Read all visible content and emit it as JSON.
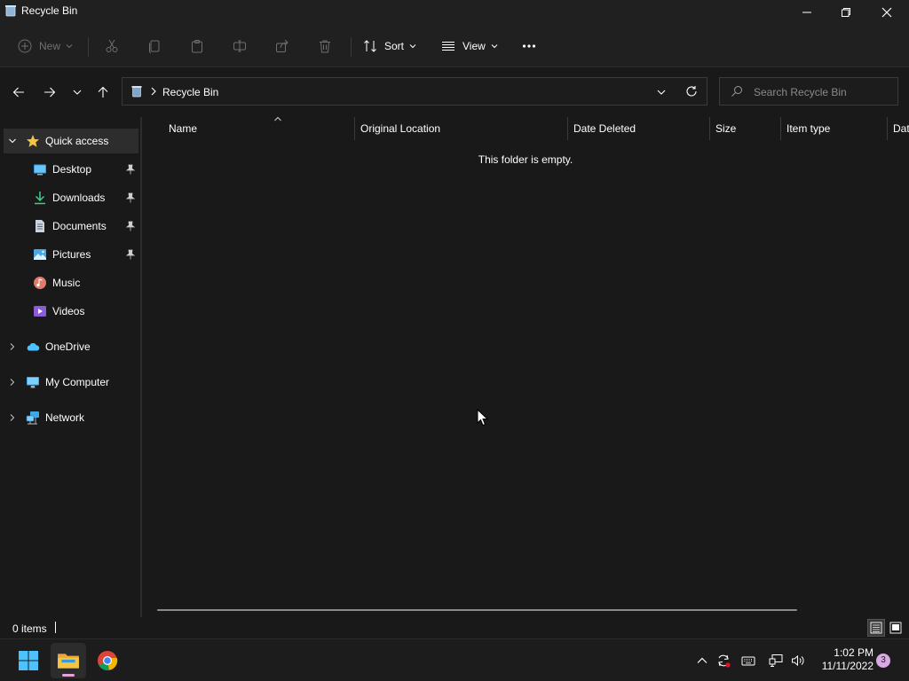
{
  "window": {
    "title": "Recycle Bin"
  },
  "commandbar": {
    "new_label": "New",
    "sort_label": "Sort",
    "view_label": "View"
  },
  "address": {
    "crumb": "Recycle Bin",
    "search_placeholder": "Search Recycle Bin"
  },
  "sidebar": {
    "quick_access": "Quick access",
    "items": [
      {
        "label": "Desktop"
      },
      {
        "label": "Downloads"
      },
      {
        "label": "Documents"
      },
      {
        "label": "Pictures"
      },
      {
        "label": "Music"
      },
      {
        "label": "Videos"
      }
    ],
    "onedrive": "OneDrive",
    "my_computer": "My Computer",
    "network": "Network"
  },
  "columns": [
    {
      "label": "Name"
    },
    {
      "label": "Original Location"
    },
    {
      "label": "Date Deleted"
    },
    {
      "label": "Size"
    },
    {
      "label": "Item type"
    },
    {
      "label": "Dat"
    }
  ],
  "content": {
    "empty_message": "This folder is empty."
  },
  "status": {
    "item_count": "0 items"
  },
  "taskbar": {
    "time": "1:02 PM",
    "date": "11/11/2022",
    "notification_count": "3"
  },
  "colors": {
    "background": "#191919",
    "chrome": "#202020",
    "selected": "#2d2d2d",
    "folder_yellow": "#f4c542",
    "accent_blue": "#4cc2ff"
  }
}
